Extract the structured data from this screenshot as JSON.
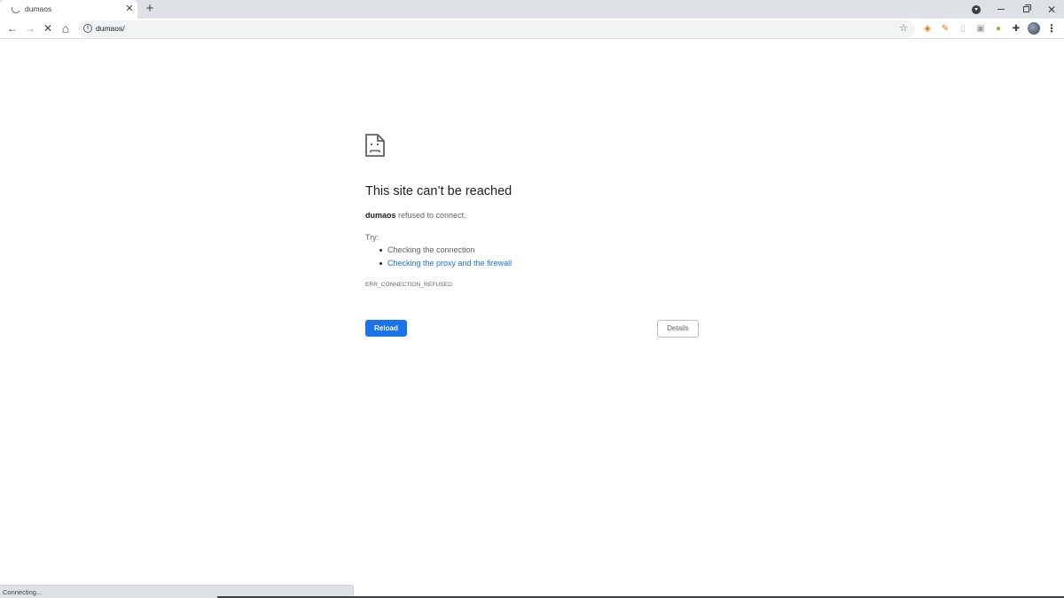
{
  "tab": {
    "title": "dumaos",
    "close_glyph": "✕"
  },
  "tabstrip": {
    "new_tab_glyph": "+",
    "close_window_glyph": "✕"
  },
  "toolbar": {
    "back_glyph": "←",
    "forward_glyph": "→",
    "stop_glyph": "✕",
    "home_glyph": "⌂",
    "url": "dumaos/",
    "info_glyph": "i",
    "star_glyph": "☆",
    "menu_glyph": "⋮"
  },
  "extensions": [
    {
      "name": "ext-diamond-icon",
      "glyph": "◈",
      "color": "#e8710a"
    },
    {
      "name": "ext-wrench-icon",
      "glyph": "✎",
      "color": "#e8710a"
    },
    {
      "name": "ext-page-icon",
      "glyph": "▯",
      "color": "#bdc1c6"
    },
    {
      "name": "ext-grey-icon",
      "glyph": "▣",
      "color": "#9aa0a6"
    },
    {
      "name": "ext-coin-icon",
      "glyph": "●",
      "color": "#b5a642"
    },
    {
      "name": "extensions-puzzle-icon",
      "glyph": "✚",
      "color": "#3c4043"
    }
  ],
  "error_page": {
    "title": "This site can’t be reached",
    "host": "dumaos",
    "message_suffix": " refused to connect.",
    "try_label": "Try:",
    "suggestions": [
      "Checking the connection",
      "Checking the proxy and the firewall"
    ],
    "error_code": "ERR_CONNECTION_REFUSED",
    "reload_label": "Reload",
    "details_label": "Details"
  },
  "status": {
    "text": "Connecting..."
  },
  "colors": {
    "accent": "#1a73e8",
    "text_primary": "#202124",
    "text_secondary": "#5f6368",
    "tabstrip_bg": "#dee1e6"
  }
}
